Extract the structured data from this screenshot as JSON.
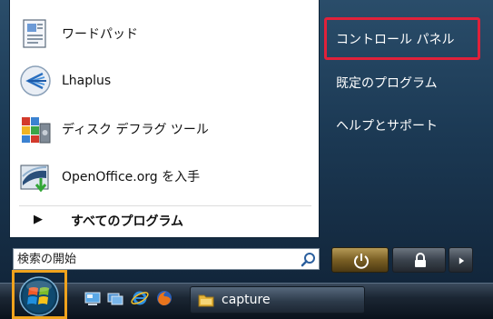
{
  "programs": [
    {
      "label": "ワードパッド",
      "icon": "wordpad-icon"
    },
    {
      "label": "Lhaplus",
      "icon": "lhaplus-icon"
    },
    {
      "label": "ディスク デフラグ ツール",
      "icon": "defrag-icon"
    },
    {
      "label": "OpenOffice.org を入手",
      "icon": "openoffice-icon"
    }
  ],
  "all_programs": {
    "label": "すべてのプログラム",
    "arrow": "▶"
  },
  "right_panel": {
    "items": [
      {
        "label": "コントロール パネル"
      },
      {
        "label": "既定のプログラム"
      },
      {
        "label": "ヘルプとサポート"
      }
    ],
    "highlight_color": "#e0213a"
  },
  "search": {
    "placeholder": "検索の開始"
  },
  "taskbar": {
    "task_buttons": [
      {
        "label": "capture",
        "icon": "folder-icon"
      }
    ],
    "quick_launch": [
      "show-desktop-icon",
      "switch-windows-icon",
      "internet-explorer-icon",
      "firefox-icon"
    ],
    "start_highlight_color": "#f0a31d"
  }
}
